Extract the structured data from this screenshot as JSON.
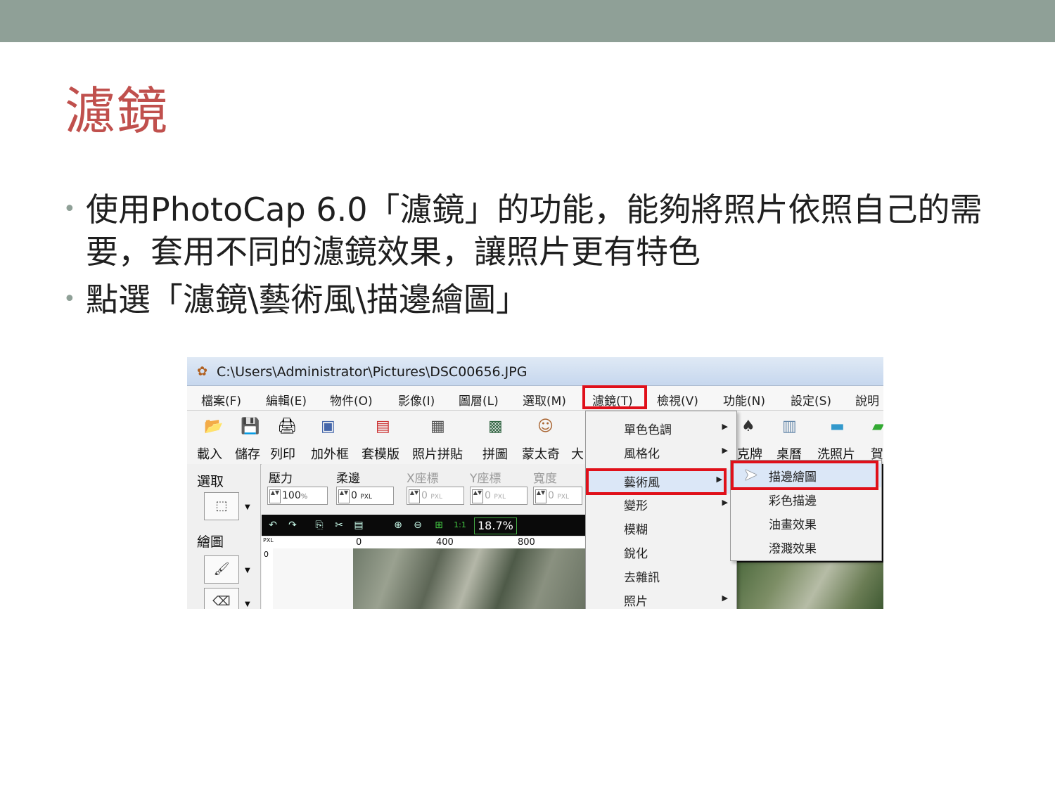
{
  "slide": {
    "title": "濾鏡",
    "bullets": [
      "使用PhotoCap 6.0「濾鏡」的功能，能夠將照片依照自己的需要，套用不同的濾鏡效果，讓照片更有特色",
      "點選「濾鏡\\藝術風\\描邊繪圖」"
    ],
    "accent_color": "#c0504d",
    "header_bar_color": "#8fa097"
  },
  "app": {
    "window_title": "C:\\Users\\Administrator\\Pictures\\DSC00656.JPG",
    "menus": [
      "檔案(F)",
      "編輯(E)",
      "物件(O)",
      "影像(I)",
      "圖層(L)",
      "選取(M)",
      "濾鏡(T)",
      "檢視(V)",
      "功能(N)",
      "設定(S)",
      "說明"
    ],
    "active_menu": "濾鏡(T)",
    "toolbar": [
      "載入",
      "儲存",
      "列印",
      "加外框",
      "套模版",
      "照片拼貼",
      "拼圖",
      "蒙太奇",
      "大"
    ],
    "toolbar_right": [
      "克牌",
      "桌曆",
      "洗照片",
      "賀"
    ],
    "left_panel": {
      "select_label": "選取",
      "draw_label": "繪圖"
    },
    "options": [
      {
        "label": "壓力",
        "value": "100",
        "unit": "%"
      },
      {
        "label": "柔邊",
        "value": "0",
        "unit": "PXL"
      },
      {
        "label": "X座標",
        "value": "0",
        "unit": "PXL"
      },
      {
        "label": "Y座標",
        "value": "0",
        "unit": "PXL"
      },
      {
        "label": "寬度",
        "value": "0",
        "unit": "PXL"
      }
    ],
    "zoom": "18.7%",
    "zoom_one_to_one": "1:1",
    "ruler": {
      "unit": "PXL",
      "ticks": [
        "0",
        "400",
        "800"
      ],
      "vtick": "0"
    },
    "filter_menu": [
      {
        "label": "單色色調",
        "submenu": true
      },
      {
        "label": "風格化",
        "submenu": true
      },
      {
        "label": "藝術風",
        "submenu": true
      },
      {
        "label": "變形",
        "submenu": true
      },
      {
        "label": "模糊",
        "submenu": false
      },
      {
        "label": "銳化",
        "submenu": false
      },
      {
        "label": "去雜訊",
        "submenu": false
      },
      {
        "label": "照片",
        "submenu": true
      }
    ],
    "active_filter": "藝術風",
    "art_submenu": [
      "描邊繪圖",
      "彩色描邊",
      "油畫效果",
      "潑濺效果"
    ],
    "active_art_item": "描邊繪圖",
    "highlight_color": "#e0101a"
  }
}
